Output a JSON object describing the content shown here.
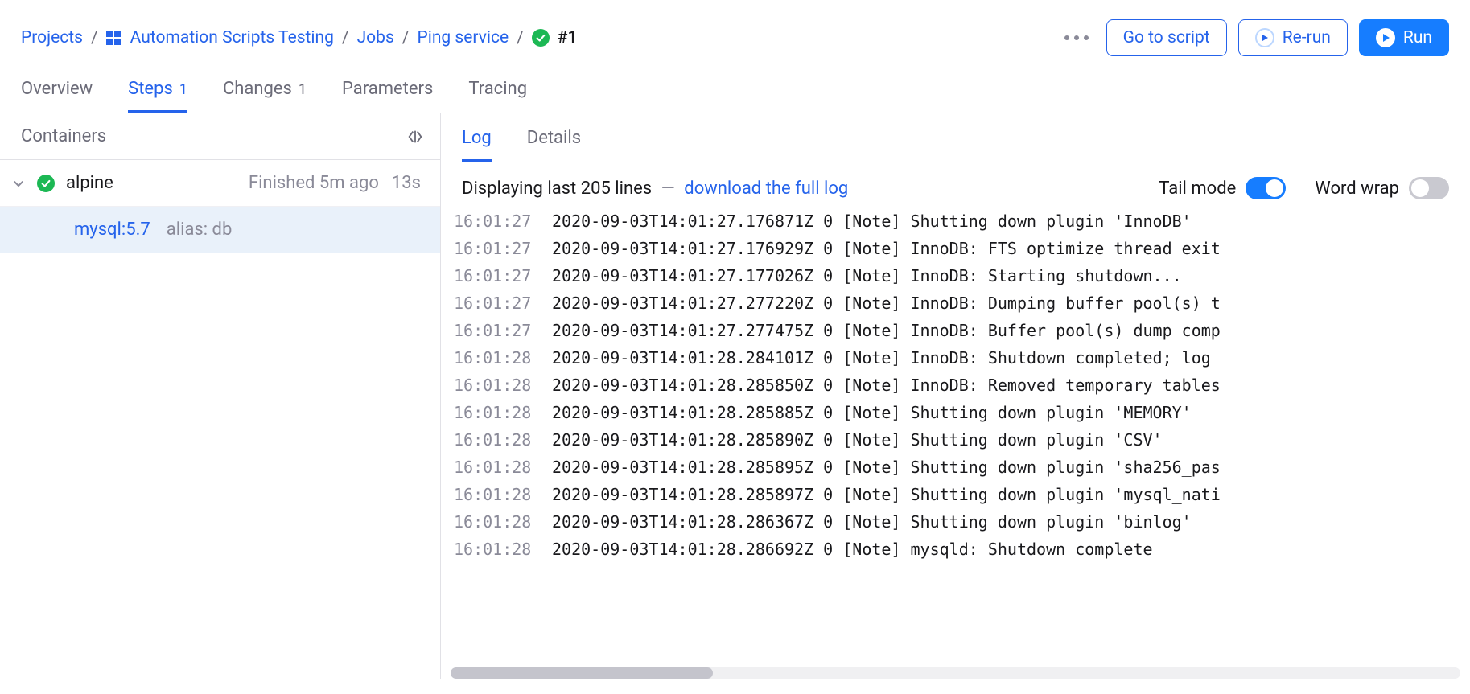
{
  "breadcrumb": {
    "projects": "Projects",
    "project": "Automation Scripts Testing",
    "jobs": "Jobs",
    "job": "Ping service",
    "run": "#1"
  },
  "actions": {
    "go_to_script": "Go to script",
    "rerun": "Re-run",
    "run": "Run"
  },
  "tabs": {
    "overview": "Overview",
    "steps": "Steps",
    "steps_count": "1",
    "changes": "Changes",
    "changes_count": "1",
    "parameters": "Parameters",
    "tracing": "Tracing"
  },
  "left": {
    "header": "Containers",
    "container": {
      "name": "alpine",
      "status": "Finished 5m ago",
      "duration": "13s",
      "service": {
        "name": "mysql:5.7",
        "alias": "alias: db"
      }
    }
  },
  "right_tabs": {
    "log": "Log",
    "details": "Details"
  },
  "log_bar": {
    "prefix": "Displaying last",
    "count": "205",
    "suffix": "lines",
    "download": "download the full log",
    "tail": "Tail mode",
    "wrap": "Word wrap"
  },
  "log": [
    {
      "t": "16:01:27",
      "m": "2020-09-03T14:01:27.176871Z 0 [Note] Shutting down plugin 'InnoDB'"
    },
    {
      "t": "16:01:27",
      "m": "2020-09-03T14:01:27.176929Z 0 [Note] InnoDB: FTS optimize thread exit"
    },
    {
      "t": "16:01:27",
      "m": "2020-09-03T14:01:27.177026Z 0 [Note] InnoDB: Starting shutdown..."
    },
    {
      "t": "16:01:27",
      "m": "2020-09-03T14:01:27.277220Z 0 [Note] InnoDB: Dumping buffer pool(s) t"
    },
    {
      "t": "16:01:27",
      "m": "2020-09-03T14:01:27.277475Z 0 [Note] InnoDB: Buffer pool(s) dump comp"
    },
    {
      "t": "16:01:28",
      "m": "2020-09-03T14:01:28.284101Z 0 [Note] InnoDB: Shutdown completed; log "
    },
    {
      "t": "16:01:28",
      "m": "2020-09-03T14:01:28.285850Z 0 [Note] InnoDB: Removed temporary tables"
    },
    {
      "t": "16:01:28",
      "m": "2020-09-03T14:01:28.285885Z 0 [Note] Shutting down plugin 'MEMORY'"
    },
    {
      "t": "16:01:28",
      "m": "2020-09-03T14:01:28.285890Z 0 [Note] Shutting down plugin 'CSV'"
    },
    {
      "t": "16:01:28",
      "m": "2020-09-03T14:01:28.285895Z 0 [Note] Shutting down plugin 'sha256_pas"
    },
    {
      "t": "16:01:28",
      "m": "2020-09-03T14:01:28.285897Z 0 [Note] Shutting down plugin 'mysql_nati"
    },
    {
      "t": "16:01:28",
      "m": "2020-09-03T14:01:28.286367Z 0 [Note] Shutting down plugin 'binlog'"
    },
    {
      "t": "16:01:28",
      "m": "2020-09-03T14:01:28.286692Z 0 [Note] mysqld: Shutdown complete"
    }
  ]
}
